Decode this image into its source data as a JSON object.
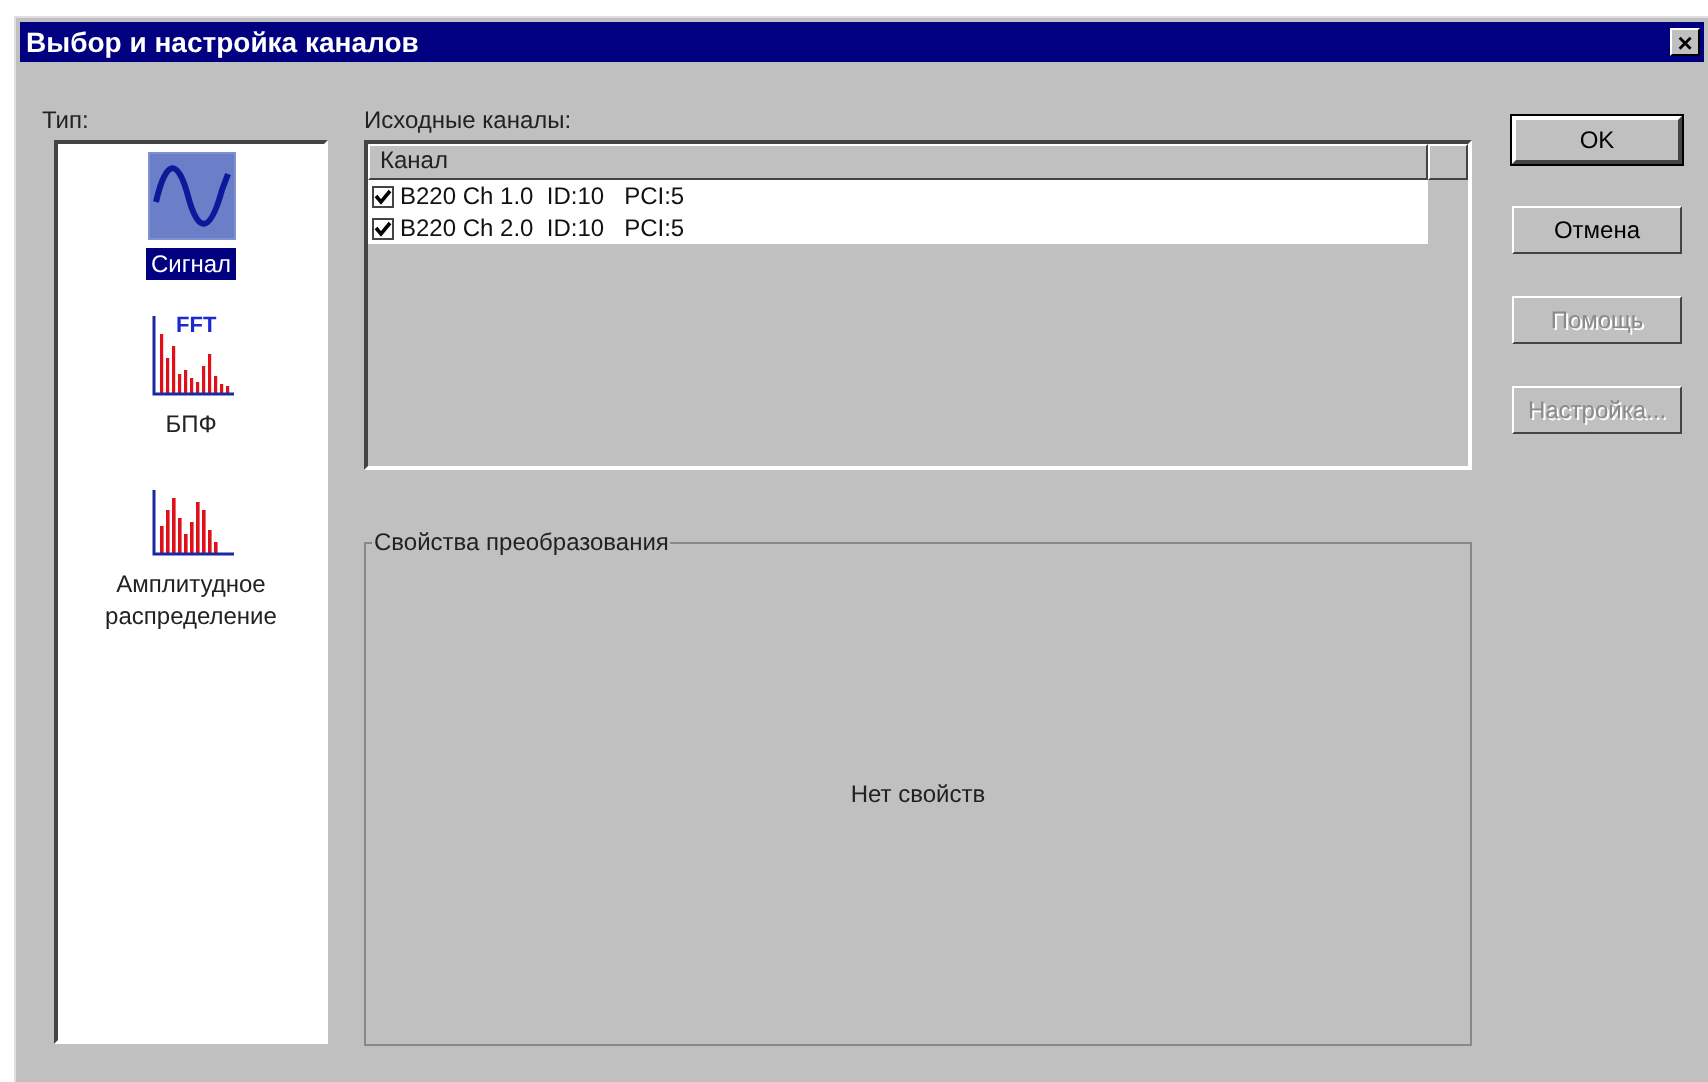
{
  "window": {
    "title": "Выбор и настройка каналов",
    "close": "×"
  },
  "type_label": "Тип:",
  "types": [
    {
      "kind": "signal",
      "label": "Сигнал",
      "selected": true
    },
    {
      "kind": "fft",
      "label": "БПФ",
      "icon_text": "FFT",
      "selected": false
    },
    {
      "kind": "histogram",
      "label": "Амплитудное распределение",
      "selected": false
    }
  ],
  "channels_label": "Исходные каналы:",
  "table": {
    "columns": [
      "Канал"
    ],
    "rows": [
      {
        "name": "B220 Ch 1.0",
        "id": "ID:10",
        "pci": "PCI:5",
        "checked": true
      },
      {
        "name": "B220 Ch 2.0",
        "id": "ID:10",
        "pci": "PCI:5",
        "checked": true
      }
    ]
  },
  "properties": {
    "title": "Свойства преобразования",
    "message": "Нет свойств"
  },
  "buttons": [
    {
      "label": "OK",
      "disabled": false,
      "default": true
    },
    {
      "label": "Отмена",
      "disabled": false,
      "default": false
    },
    {
      "label": "Помощь",
      "disabled": true,
      "default": false
    },
    {
      "label": "Настройка...",
      "disabled": true,
      "default": false
    }
  ]
}
